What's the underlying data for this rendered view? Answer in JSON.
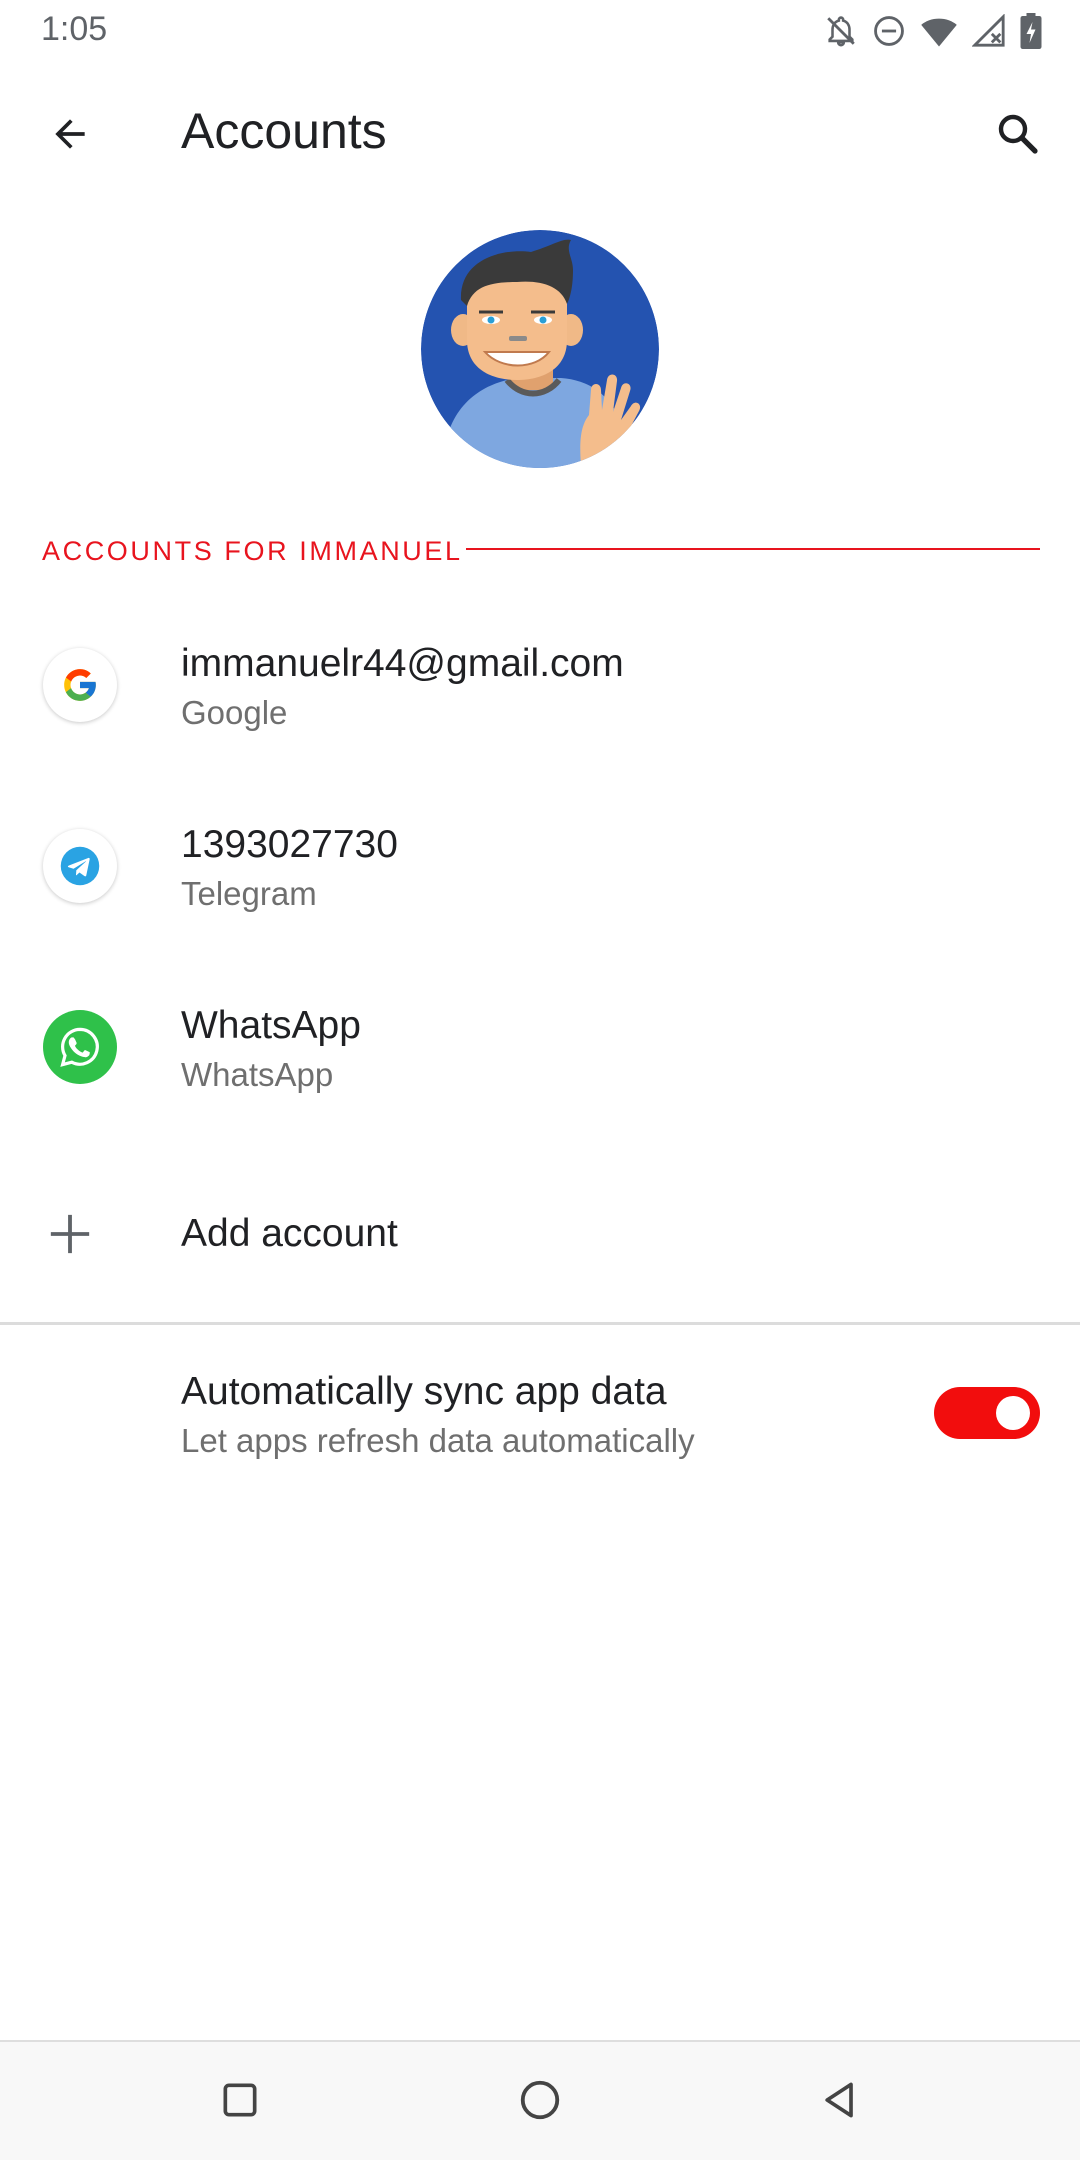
{
  "status_bar": {
    "time": "1:05",
    "icons": [
      "notifications-off-icon",
      "do-not-disturb-icon",
      "wifi-icon",
      "signal-icon",
      "battery-charging-icon"
    ]
  },
  "toolbar": {
    "title": "Accounts",
    "back_icon": "arrow-back-icon",
    "search_icon": "search-icon"
  },
  "profile": {
    "avatar_icon": "user-avatar-illustration"
  },
  "section": {
    "header": "ACCOUNTS FOR IMMANUEL",
    "accent_color": "#e8141e"
  },
  "accounts": [
    {
      "title": "immanuelr44@gmail.com",
      "subtitle": "Google",
      "icon": "google-icon"
    },
    {
      "title": "1393027730",
      "subtitle": "Telegram",
      "icon": "telegram-icon"
    },
    {
      "title": "WhatsApp",
      "subtitle": "WhatsApp",
      "icon": "whatsapp-icon"
    }
  ],
  "add_account": {
    "label": "Add account",
    "icon": "plus-icon"
  },
  "sync": {
    "title": "Automatically sync app data",
    "subtitle": "Let apps refresh data automatically",
    "enabled": true,
    "toggle_color": "#f20d0d"
  },
  "nav_bar": {
    "icons": [
      "recents-icon",
      "home-icon",
      "back-icon"
    ]
  }
}
